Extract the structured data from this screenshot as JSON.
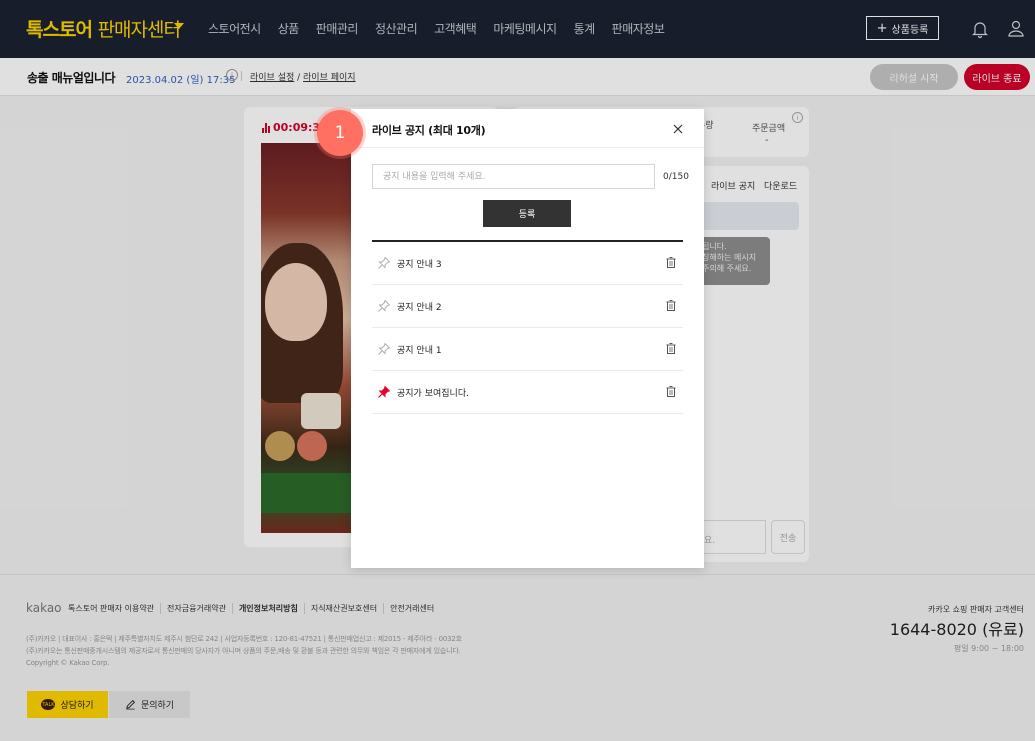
{
  "brand": {
    "main": "톡스토어",
    "sub": "판매자센터"
  },
  "nav": {
    "items": [
      "스토어전시",
      "상품",
      "판매관리",
      "정산관리",
      "고객혜택",
      "마케팅메시지",
      "통계",
      "판매자정보"
    ]
  },
  "header_actions": {
    "register_label": "상품등록"
  },
  "subheader": {
    "title": "송출 매뉴얼입니다",
    "datetime": "2023.04.02 (일) 17:35",
    "link_settings": "라이브 설정",
    "link_slash": " / ",
    "link_page": "라이브 페이지",
    "rehearsal_label": "리허설 시작",
    "end_label": "라이브 종료"
  },
  "video": {
    "timer": "00:09:3"
  },
  "stats": {
    "qty_label": "수량",
    "amount_label": "주문금액",
    "amount_value": "-"
  },
  "chat": {
    "tab_notice": "라이브 공지",
    "tab_download": "다운로드",
    "bubble_lines": [
      "됩니다.",
      "칭해하는 메시지",
      "주의해 주세요."
    ],
    "input_placeholder": "요.",
    "send_label": "전송"
  },
  "modal": {
    "title": "라이브 공지 (최대 10개)",
    "input_placeholder": "공지 내용을 입력해 주세요.",
    "counter": "0/150",
    "submit_label": "등록",
    "notices": [
      {
        "text": "공지 안내 3",
        "pinned": false
      },
      {
        "text": "공지 안내 2",
        "pinned": false
      },
      {
        "text": "공지 안내 1",
        "pinned": false
      },
      {
        "text": "공지가 보여집니다.",
        "pinned": true
      }
    ]
  },
  "step_badge": "1",
  "footer": {
    "logo": "kakao",
    "links": [
      "톡스토어 판매자 이용약관",
      "전자금융거래약관",
      "개인정보처리방침",
      "지식재산권보호센터",
      "안전거래센터"
    ],
    "info_line1": "(주)카카오 | 대표이사 : 홍은택 | 제주특별자치도 제주시 첨단로 242 | 사업자등록번호 : 120-81-47521 | 통신판매업신고 : 제2015 - 제주아라 - 0032호",
    "info_line2": "(주)카카오는 통신판매중개시스템의 제공자로서 통신판매의 당사자가 아니며 상품의 주문,배송 및 환불 등과 관련한 의무와 책임은 각 판매자에게 있습니다.",
    "copyright": "Copyright © Kakao Corp.",
    "cs_title": "카카오 쇼핑 판매자 고객센터",
    "cs_phone": "1644-8020 (유료)",
    "cs_hours": "평일 9:00 ~ 18:00",
    "btn_chat": "상담하기",
    "btn_ask": "문의하기",
    "talk_icon_text": "TALK"
  },
  "colors": {
    "nav_bg": "#1b2232",
    "brand": "#ffd400",
    "danger": "#d4002a",
    "accent_blue": "#2d5fc2",
    "badge": "#ff7062"
  },
  "icons": {
    "bell": "bell-icon",
    "user": "user-icon",
    "close": "close-icon",
    "pin": "pin-icon",
    "trash": "trash-icon"
  }
}
